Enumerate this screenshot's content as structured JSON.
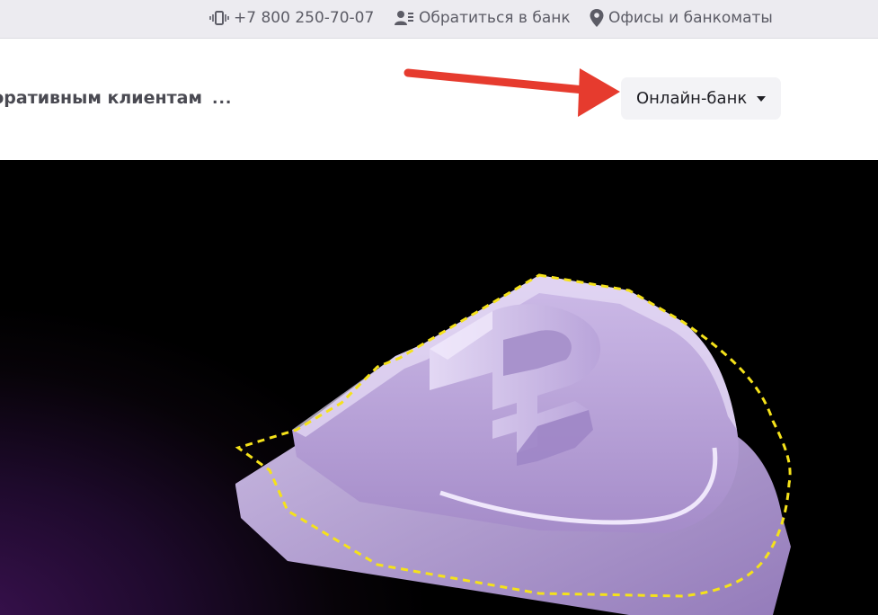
{
  "topbar": {
    "phone_label": "+7 800 250-70-07",
    "phone_icon": "phone-vibrate-icon",
    "contact_label": "Обратиться в банк",
    "contact_icon": "user-card-icon",
    "offices_label": "Офисы и банкоматы",
    "offices_icon": "map-pin-icon"
  },
  "navbar": {
    "corporate_label": "Корпоративным клиентам",
    "more_label": "...",
    "online_bank_label": "Онлайн-банк",
    "online_bank_icon": "caret-down-icon"
  },
  "annotation": {
    "arrow_color": "#e63b2e"
  },
  "hero": {
    "image": "purple-ruble-shield-illustration",
    "colors": {
      "background_dark": "#000000",
      "background_purple": "#3a1150",
      "shield": "#b8a3d6",
      "outline": "#f5e21a"
    }
  }
}
